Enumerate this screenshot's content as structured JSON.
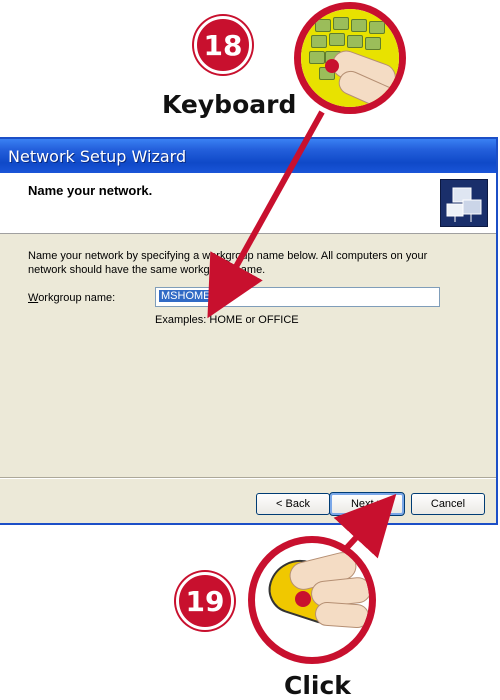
{
  "steps": {
    "step1": {
      "number": "18",
      "label": "Keyboard"
    },
    "step2": {
      "number": "19",
      "label": "Click"
    }
  },
  "dialog": {
    "title": "Network Setup Wizard",
    "header": "Name your network.",
    "description": "Name your network by specifying a workgroup name below. All computers on your network should have the same workgroup name.",
    "workgroup_label": "Workgroup name:",
    "workgroup_value": "MSHOME",
    "examples": "Examples: HOME or OFFICE",
    "buttons": {
      "back": "< Back",
      "next": "Next >",
      "cancel": "Cancel"
    }
  },
  "colors": {
    "accent": "#c8102e",
    "titlebar": "#0f49c8",
    "dialog_bg": "#ece9d8"
  },
  "icons": [
    "keyboard-icon",
    "mouse-icon",
    "network-wizard-icon"
  ]
}
